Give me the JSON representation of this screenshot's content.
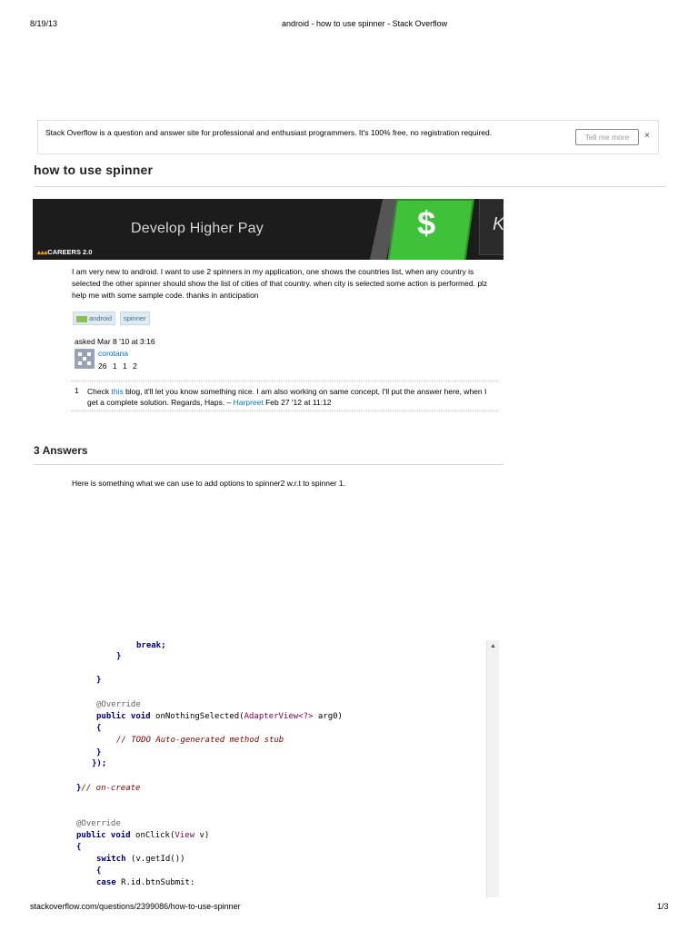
{
  "print_header": {
    "date": "8/19/13",
    "title": "android - how to use spinner - Stack Overflow"
  },
  "print_footer": {
    "url": "stackoverflow.com/questions/2399086/how-to-use-spinner",
    "page": "1/3"
  },
  "banner": {
    "text": "Stack Overflow is a question and answer site for professional and enthusiast programmers. It's 100% free, no registration required.",
    "button_label": "Tell me more",
    "close": "×"
  },
  "question": {
    "title": "how to use spinner",
    "body": "I am very new to android. I want to use 2 spinners in my application, one shows the countries list, when any country is selected the other spinner should show the list of cities of that country. when city is selected some action is performed. plz help me with some sample code. thanks in anticipation",
    "tags": [
      "android",
      "spinner"
    ],
    "asked": "asked Mar 8 '10 at 3:16",
    "user": {
      "name": "corotana",
      "rep": "26",
      "badge_gold": "1",
      "badge_silver": "1",
      "badge_bronze": "2"
    }
  },
  "ad": {
    "text": "Develop Higher Pay",
    "logo": "CAREERS 2.0",
    "key1": "$",
    "key2": "K"
  },
  "comment": {
    "score": "1",
    "text_pre": "Check ",
    "link": "this",
    "text_post": " blog, it'll let you know something nice. I am also working on same concept, I'll put the answer here, when I get a complete solution. Regards, Haps. –",
    "author": "Harpreet",
    "date": " Feb 27 '12 at 11:12"
  },
  "answers": {
    "title": "3 Answers",
    "first_text": "Here is something what we can use to add options to spinner2 w.r.t to spinner 1."
  },
  "code": {
    "scroll_up": "▲",
    "lines": [
      {
        "t": "break;",
        "c": "kw"
      },
      {
        "t": "}",
        "c": "kw"
      },
      {
        "t": "}",
        "c": "kw"
      },
      {
        "t": "@Override",
        "c": "an"
      },
      {
        "t": "public void ",
        "c": "kw"
      },
      {
        "t": "onNothingSelected(",
        "c": "tx"
      },
      {
        "t": "AdapterView<?>",
        "c": "ty"
      },
      {
        "t": " arg0)",
        "c": "tx"
      },
      {
        "t": "{",
        "c": "kw"
      },
      {
        "t": "// TODO Auto-generated method stub",
        "c": "cm"
      },
      {
        "t": "}",
        "c": "kw"
      },
      {
        "t": "});",
        "c": "kw"
      },
      {
        "t": "}",
        "c": "kw"
      },
      {
        "t": "// on-create",
        "c": "cm"
      },
      {
        "t": "@Override",
        "c": "an"
      },
      {
        "t": "public void ",
        "c": "kw"
      },
      {
        "t": "onClick(",
        "c": "tx"
      },
      {
        "t": "View",
        "c": "ty"
      },
      {
        "t": " v)",
        "c": "tx"
      },
      {
        "t": "{",
        "c": "kw"
      },
      {
        "t": "switch ",
        "c": "kw"
      },
      {
        "t": "(v.getId())",
        "c": "tx"
      },
      {
        "t": "{",
        "c": "kw"
      },
      {
        "t": "case ",
        "c": "kw"
      },
      {
        "t": "R.id.btnSubmit:",
        "c": "tx"
      }
    ]
  }
}
